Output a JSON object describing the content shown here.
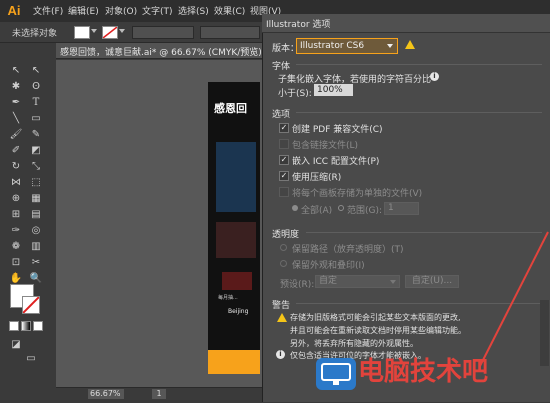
{
  "app": {
    "logo": "Ai"
  },
  "menu": [
    "文件(F)",
    "编辑(E)",
    "对象(O)",
    "文字(T)",
    "选择(S)",
    "效果(C)",
    "视图(V)"
  ],
  "control_bar": {
    "no_selection": "未选择对象"
  },
  "document": {
    "tab_title": "感恩回馈，诚意巨献.ai* @ 66.67% (CMYK/预览)",
    "zoom": "66.67%",
    "page": "1"
  },
  "artboard": {
    "headline": "感恩回",
    "footer": "Beijing",
    "offer": "每月抽..."
  },
  "dialog": {
    "title": "Illustrator 选项",
    "version_label": "版本：",
    "version_value": "Illustrator CS6",
    "fonts_section": "字体",
    "subset_line1": "子集化嵌入字体，若使用的字符百分比",
    "subset_line2": "小于(S):",
    "subset_value": "100%",
    "options_section": "选项",
    "opt_pdf": "创建 PDF 兼容文件(C)",
    "opt_linked": "包含链接文件(L)",
    "opt_icc": "嵌入 ICC 配置文件(P)",
    "opt_compress": "使用压缩(R)",
    "opt_artboards": "将每个画板存储为单独的文件(V)",
    "radio_all": "全部(A)",
    "radio_range": "范围(G):",
    "range_value": "1",
    "transparency_section": "透明度",
    "trans_paths": "保留路径（放弃透明度）(T)",
    "trans_appearance": "保留外观和叠印(I)",
    "preset_label": "预设(R):",
    "preset_value": "自定",
    "custom_button": "自定(U)...",
    "warnings_section": "警告",
    "warn_text1": "存储为旧版格式可能会引起某些文本版面的更改,",
    "warn_text2": "并且可能会在重新读取文档时停用某些编辑功能。",
    "warn_text3": "另外，将丢弃所有隐藏的外观属性。",
    "info_text": "仅包含适当许可位的字体才能被嵌入。"
  },
  "watermark": {
    "text": "电脑技术吧"
  },
  "colors": {
    "accent": "#f7a21b",
    "watermark": "#e2433c",
    "field": "#d8d8d8"
  }
}
